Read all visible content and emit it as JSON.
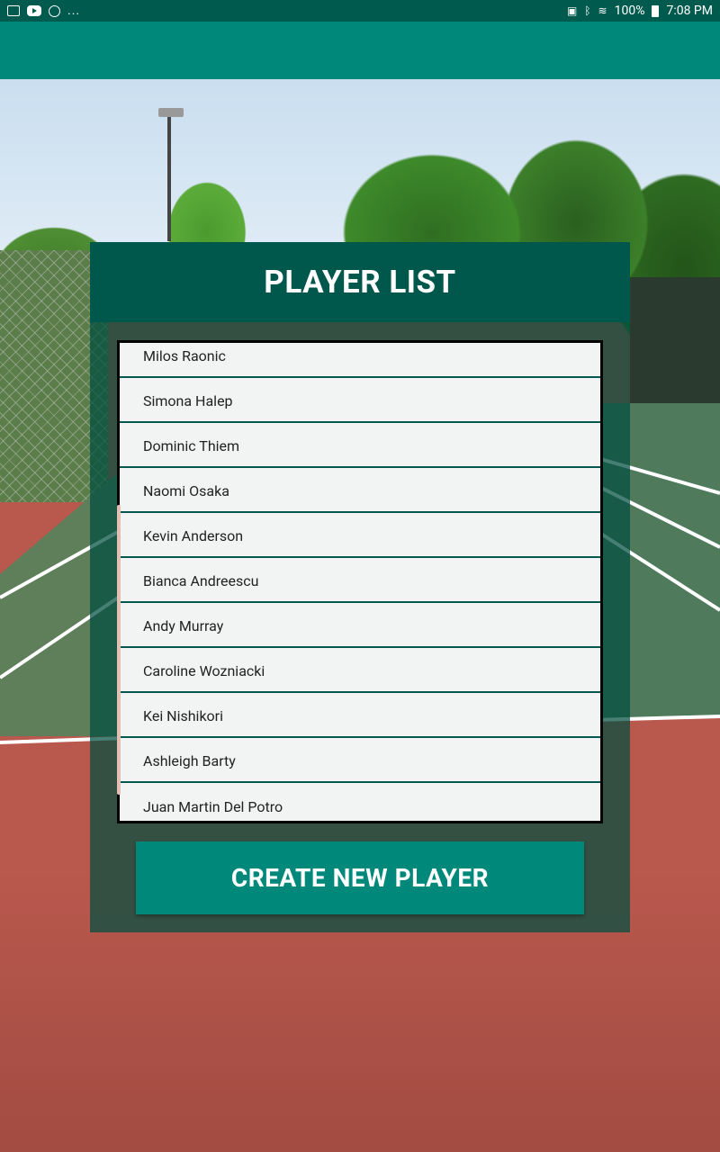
{
  "status_bar": {
    "battery": "100%",
    "time": "7:08 PM",
    "overflow": "..."
  },
  "card": {
    "title": "PLAYER LIST"
  },
  "players": [
    "Milos Raonic",
    "Simona Halep",
    "Dominic Thiem",
    "Naomi Osaka",
    "Kevin Anderson",
    "Bianca Andreescu",
    "Andy Murray",
    "Caroline Wozniacki",
    "Kei Nishikori",
    "Ashleigh Barty",
    "Juan Martin Del Potro"
  ],
  "actions": {
    "create_label": "CREATE NEW PLAYER"
  },
  "colors": {
    "status_bar": "#005a4e",
    "app_bar": "#00897b",
    "card_header": "#00574b",
    "button": "#00897b",
    "divider": "#00574b"
  }
}
